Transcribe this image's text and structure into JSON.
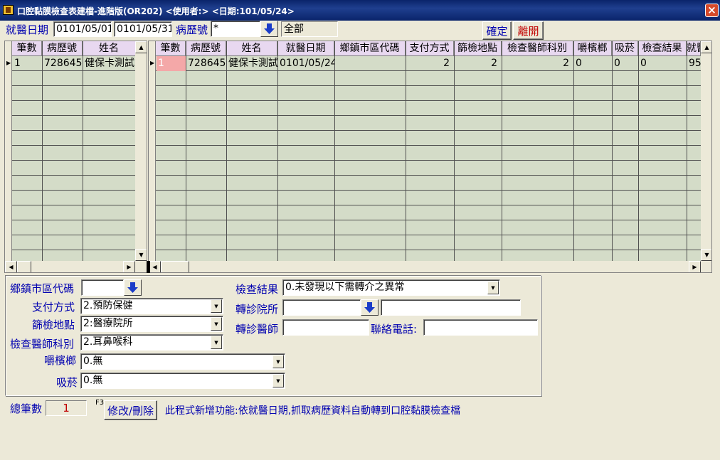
{
  "window": {
    "title": "口腔黏膜檢查表建檔-進階版(OR202)  <使用者:>  <日期:101/05/24>",
    "close_label": "×"
  },
  "filter": {
    "date_label": "就醫日期",
    "date_from": "0101/05/01",
    "date_to": "0101/05/31",
    "chart_label": "病歷號",
    "chart_value": "*",
    "chart_desc": "全部"
  },
  "toolbar": {
    "ok_label": "確定",
    "exit_label": "離開"
  },
  "left_grid": {
    "columns": [
      "筆數",
      "病歷號",
      "姓名"
    ],
    "rows": [
      [
        "1",
        "728645",
        "健保卡測試"
      ]
    ]
  },
  "right_grid": {
    "columns": [
      "筆數",
      "病歷號",
      "姓名",
      "就醫日期",
      "鄉鎮市區代碼",
      "支付方式",
      "篩檢地點",
      "檢查醫師科別",
      "嚼檳榔",
      "吸菸",
      "檢查結果",
      "就醫"
    ],
    "rows": [
      [
        "1",
        "728645",
        "健保卡測試",
        "0101/05/24",
        "",
        "2",
        "2",
        "2",
        "0",
        "0",
        "0",
        "95"
      ]
    ]
  },
  "form": {
    "town_label": "鄉鎮市區代碼",
    "town_value": "",
    "pay_label": "支付方式",
    "pay_value": "2.預防保健",
    "site_label": "篩檢地點",
    "site_value": "2:醫療院所",
    "dept_label": "檢查醫師科別",
    "dept_value": "2.耳鼻喉科",
    "betel_label": "嚼檳榔",
    "betel_value": "0.無",
    "smoke_label": "吸菸",
    "smoke_value": "0.無",
    "result_label": "檢查結果",
    "result_value": "0.未發現以下需轉介之異常",
    "hosp_label": "轉診院所",
    "hosp_value": "",
    "hosp_name": "",
    "doctor_label": "轉診醫師",
    "doctor_value": "",
    "phone_label": "聯絡電話:",
    "phone_value": ""
  },
  "footer": {
    "total_label": "總筆數",
    "total_value": "1",
    "hotkey": "F3",
    "edit_label": "修改/刪除",
    "note": "此程式新增功能:依就醫日期,抓取病歷資料自動轉到口腔黏膜檢查檔"
  },
  "colors": {
    "label": "#0000b0",
    "header": "#e8d8f0",
    "grid_bg": "#d4dcc8",
    "selected": "#f4a8a8",
    "title_bar": "#0a246a",
    "arrow": "#1a3cc8",
    "exit": "#c00000"
  }
}
